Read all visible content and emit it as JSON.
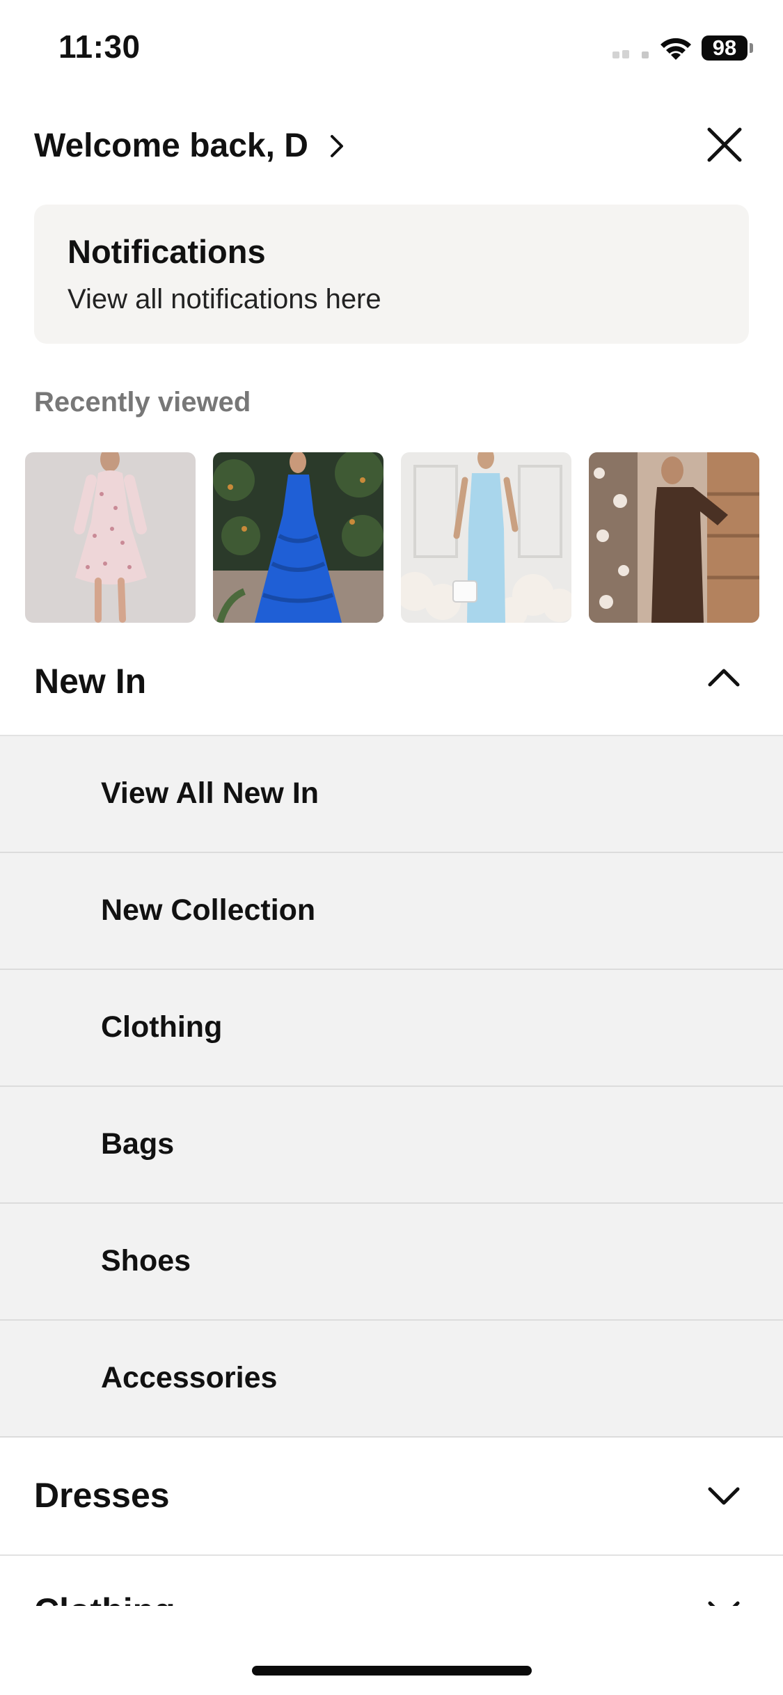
{
  "status_bar": {
    "time": "11:30",
    "battery": "98"
  },
  "header": {
    "welcome": "Welcome back, D"
  },
  "notifications": {
    "title": "Notifications",
    "subtitle": "View all notifications here"
  },
  "recently_viewed": {
    "label": "Recently viewed"
  },
  "sections": {
    "new_in": {
      "label": "New In",
      "expanded": true,
      "items": [
        {
          "label": "View All New In"
        },
        {
          "label": "New Collection"
        },
        {
          "label": "Clothing"
        },
        {
          "label": "Bags"
        },
        {
          "label": "Shoes"
        },
        {
          "label": "Accessories"
        }
      ]
    },
    "dresses": {
      "label": "Dresses",
      "expanded": false
    },
    "clothing": {
      "label": "Clothing",
      "expanded": false
    }
  },
  "icons": {
    "close": "close-icon",
    "chevron_right": "chevron-right-icon",
    "chevron_up": "chevron-up-icon",
    "chevron_down": "chevron-down-icon"
  }
}
